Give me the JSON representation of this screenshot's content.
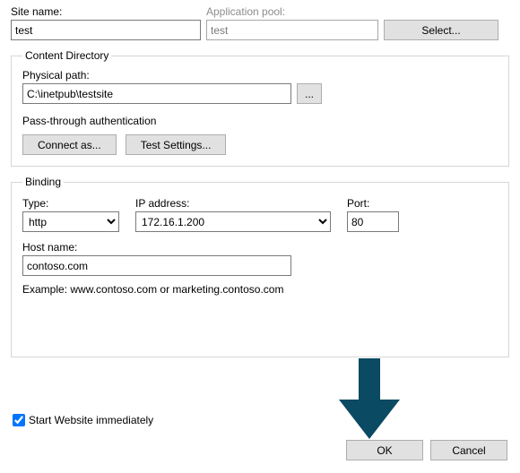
{
  "top": {
    "site_name_label": "Site name:",
    "site_name_value": "test",
    "app_pool_label": "Application pool:",
    "app_pool_value": "test",
    "select_label": "Select..."
  },
  "content_dir": {
    "legend": "Content Directory",
    "phys_path_label": "Physical path:",
    "phys_path_value": "C:\\inetpub\\testsite",
    "browse_label": "...",
    "pta_label": "Pass-through authentication",
    "connect_as_label": "Connect as...",
    "test_settings_label": "Test Settings..."
  },
  "binding": {
    "legend": "Binding",
    "type_label": "Type:",
    "type_value": "http",
    "ip_label": "IP address:",
    "ip_value": "172.16.1.200",
    "port_label": "Port:",
    "port_value": "80",
    "host_label": "Host name:",
    "host_value": "contoso.com",
    "example": "Example: www.contoso.com or marketing.contoso.com"
  },
  "footer": {
    "start_immediately": "Start Website immediately",
    "ok": "OK",
    "cancel": "Cancel"
  }
}
